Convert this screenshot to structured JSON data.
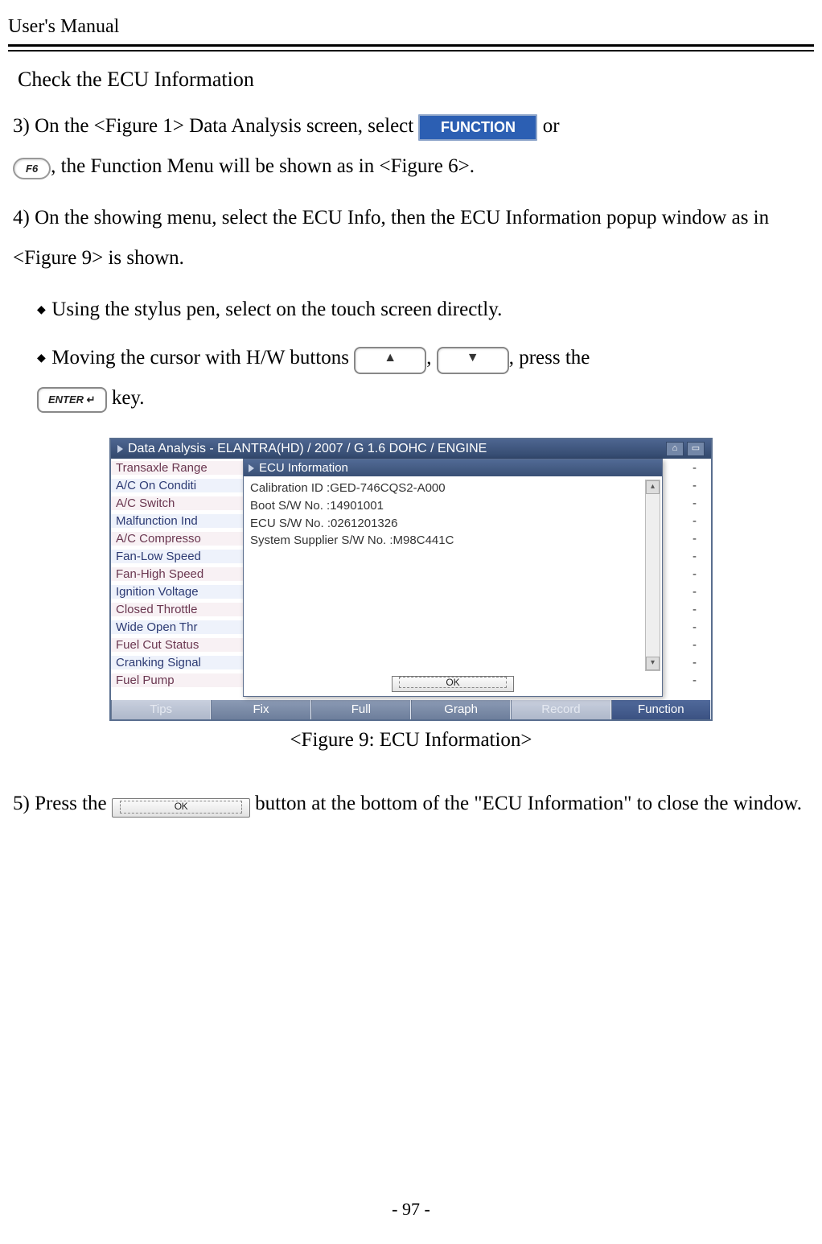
{
  "header": {
    "title": "User's Manual"
  },
  "section_title": "Check the ECU Information",
  "step3": {
    "pre": "3) On  the  <Figure  1>  Data  Analysis  screen,  select ",
    "post_or": " or",
    "line2_post": ", the Function Menu will be shown as in <Figure 6>."
  },
  "buttons": {
    "function_label": "FUNCTION",
    "f6_label": "F6",
    "enter_label": "ENTER",
    "ok_label": "OK"
  },
  "step4": "4) On the showing menu, select the ECU Info, then the ECU Information popup window as in <Figure 9> is shown.",
  "bullet1": "Using the stylus pen, select on the touch screen directly.",
  "bullet2_pre": "Moving the cursor with H/W buttons ",
  "bullet2_mid": ", ",
  "bullet2_post": ", press the ",
  "bullet2_key": " key.",
  "figure": {
    "title": "Data Analysis - ELANTRA(HD) / 2007 / G 1.6 DOHC / ENGINE",
    "params": [
      "Transaxle Range",
      "A/C On Conditi",
      "A/C Switch",
      "Malfunction Ind",
      "A/C Compresso",
      "Fan-Low Speed",
      "Fan-High Speed",
      "Ignition Voltage",
      "Closed Throttle",
      "Wide Open Thr",
      "Fuel Cut Status",
      "Cranking Signal",
      "Fuel Pump"
    ],
    "vals": [
      "-",
      "-",
      "-",
      "-",
      "-",
      "-",
      "-",
      "-",
      "-",
      "-",
      "-",
      "-",
      "-"
    ],
    "popup_title": "ECU Information",
    "popup_lines": [
      "Calibration ID :GED-746CQS2-A000",
      "Boot S/W No. :14901001",
      "ECU S/W No. :0261201326",
      "System Supplier S/W No. :M98C441C"
    ],
    "foot": [
      "Tips",
      "Fix",
      "Full",
      "Graph",
      "Record",
      "Function"
    ]
  },
  "caption": "<Figure 9: ECU Information>",
  "step5_pre": "5) Press the ",
  "step5_post": " button at the bottom of the \"ECU Information\" to close the window.",
  "page_number": "- 97 -"
}
